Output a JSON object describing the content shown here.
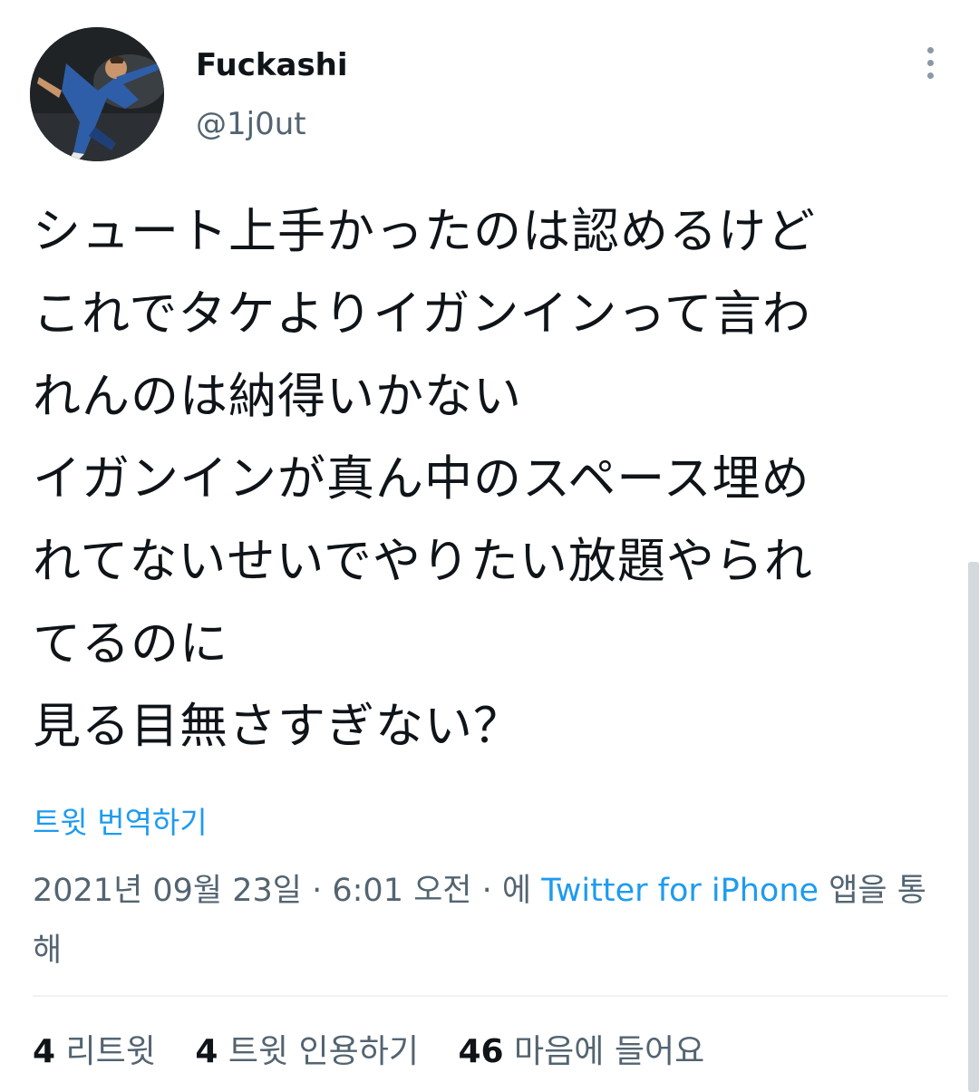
{
  "user": {
    "display_name": "Fuckashi",
    "handle": "@1j0ut"
  },
  "tweet": {
    "text": "シュート上手かったのは認めるけど\nこれでタケよりイガンインって言わ\nれんのは納得いかない\nイガンインが真ん中のスペース埋め\nれてないせいでやりたい放題やられ\nてるのに\n見る目無さすぎない？",
    "translate_label": "트윗 번역하기"
  },
  "meta": {
    "timestamp": "2021년 09월 23일 · 6:01 오전 · 에",
    "source": "Twitter for iPhone",
    "suffix": "앱을 통해"
  },
  "stats": {
    "retweets_count": "4",
    "retweets_label": "리트윗",
    "quotes_count": "4",
    "quotes_label": "트윗 인용하기",
    "likes_count": "46",
    "likes_label": "마음에 들어요"
  },
  "icons": {
    "more": "more-vertical-icon",
    "avatar": "avatar-image"
  },
  "colors": {
    "link": "#1d9bf0",
    "secondary_text": "#536471",
    "primary_text": "#0f1419"
  }
}
